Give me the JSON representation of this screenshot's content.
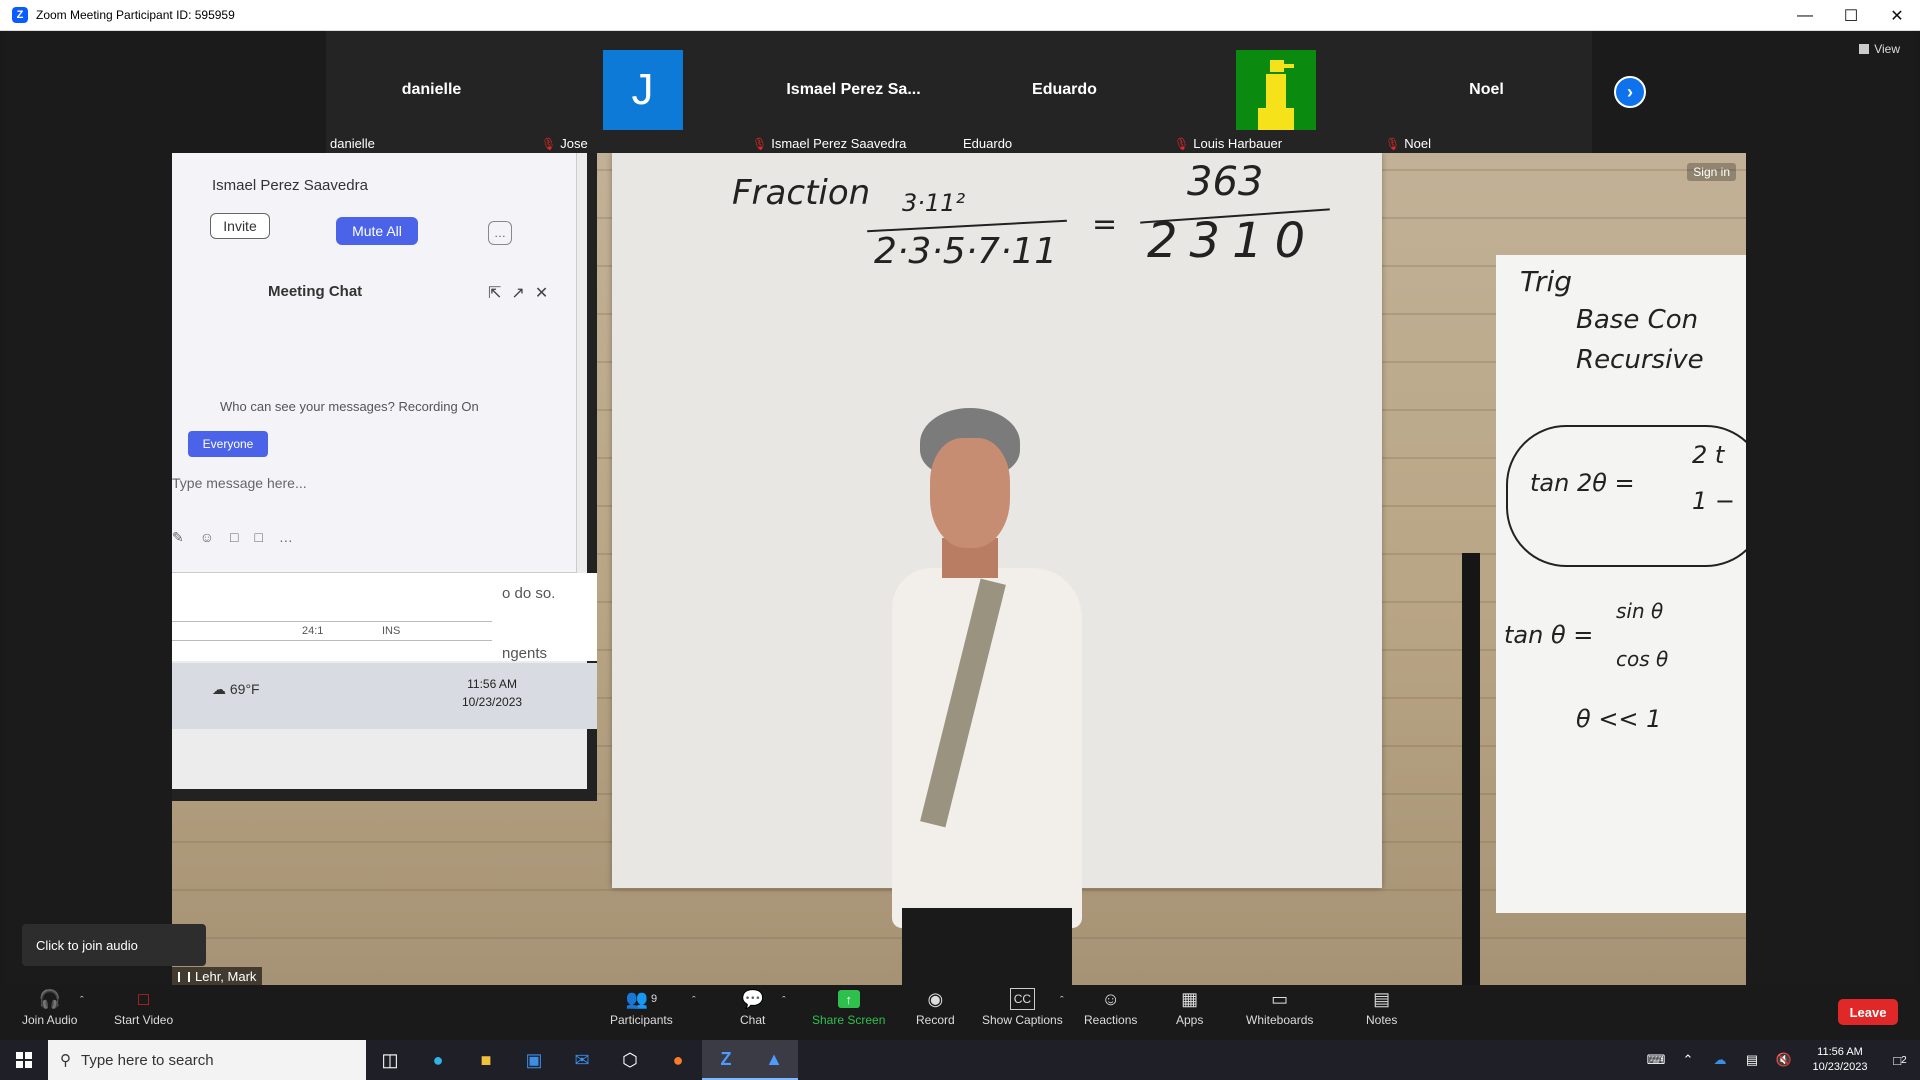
{
  "window": {
    "title": "Zoom Meeting Participant ID: 595959",
    "controls": [
      "minimize",
      "maximize",
      "close"
    ]
  },
  "view_label": "View",
  "participants_strip": [
    {
      "center": "danielle",
      "label": "danielle",
      "muted": false,
      "avatar": "none"
    },
    {
      "center": "J",
      "label": "Jose",
      "muted": true,
      "avatar": "letter"
    },
    {
      "center": "Ismael Perez Sa...",
      "label": "Ismael Perez Saavedra",
      "muted": true,
      "avatar": "none"
    },
    {
      "center": "Eduardo",
      "label": "Eduardo",
      "muted": false,
      "avatar": "none"
    },
    {
      "center": "",
      "label": "Louis Harbauer",
      "muted": true,
      "avatar": "pixel-bird"
    },
    {
      "center": "Noel",
      "label": "Noel",
      "muted": true,
      "avatar": "none"
    }
  ],
  "main_video": {
    "sign_in": "Sign in",
    "speaker_name": "Lehr, Mark",
    "projected": {
      "participant": "Ismael Perez Saavedra",
      "invite": "Invite",
      "mute_all": "Mute All",
      "chat_title": "Meeting Chat",
      "who_can_see": "Who can see your messages? Recording On",
      "everyone": "Everyone",
      "type_message": "Type message here...",
      "doc_fragment_1": "o do so.",
      "doc_fragment_2": "ngents",
      "status_ratio": "24:1",
      "status_ins": "INS",
      "weather": "69°F",
      "time": "11:56 AM",
      "date": "10/23/2023"
    },
    "whiteboard": {
      "word": "Fraction",
      "numerator": "3·11²",
      "denominator": "2·3·5·7·11",
      "equals": "=",
      "result_num": "363",
      "result_den": "2310"
    },
    "right_board": {
      "line1": "Trig",
      "line2": "Base Con",
      "line3": "Recursive",
      "eq1": "tan 2θ =",
      "eq1_frac_top": "2 t",
      "eq1_frac_bot": "1 −",
      "eq2": "tan θ =",
      "eq2_top": "sin θ",
      "eq2_bot": "cos θ",
      "eq3": "θ << 1"
    }
  },
  "tooltip": "Click to join audio",
  "toolbar": {
    "join_audio": "Join Audio",
    "start_video": "Start Video",
    "participants": "Participants",
    "participants_count": "9",
    "chat": "Chat",
    "share_screen": "Share Screen",
    "record": "Record",
    "show_captions": "Show Captions",
    "reactions": "Reactions",
    "apps": "Apps",
    "whiteboards": "Whiteboards",
    "notes": "Notes",
    "leave": "Leave"
  },
  "taskbar": {
    "search_placeholder": "Type here to search",
    "time": "11:56 AM",
    "date": "10/23/2023",
    "notification_count": "2"
  }
}
